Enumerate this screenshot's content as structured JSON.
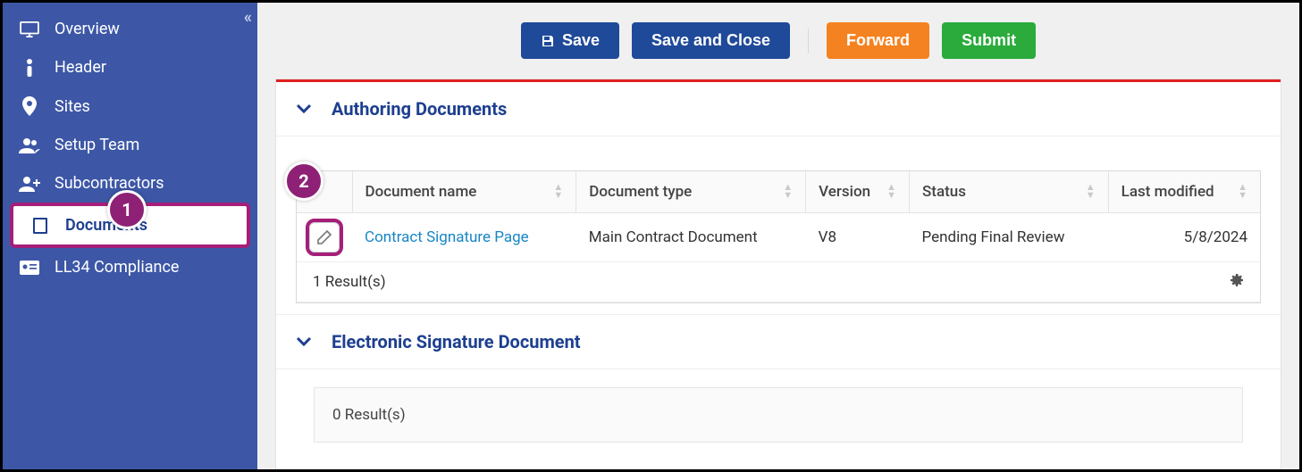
{
  "sidebar": {
    "items": [
      {
        "label": "Overview"
      },
      {
        "label": "Header"
      },
      {
        "label": "Sites"
      },
      {
        "label": "Setup Team"
      },
      {
        "label": "Subcontractors"
      },
      {
        "label": "Documents"
      },
      {
        "label": "LL34 Compliance"
      }
    ]
  },
  "toolbar": {
    "save": "Save",
    "save_close": "Save and Close",
    "forward": "Forward",
    "submit": "Submit"
  },
  "panel": {
    "title": "Authoring Documents",
    "columns": {
      "doc_name": "Document name",
      "doc_type": "Document type",
      "version": "Version",
      "status": "Status",
      "last_modified": "Last modified"
    },
    "row": {
      "doc_name": "Contract Signature Page",
      "doc_type": "Main Contract Document",
      "version": "V8",
      "status": "Pending Final Review",
      "last_modified": "5/8/2024"
    },
    "result_text": "1 Result(s)"
  },
  "sig_panel": {
    "title": "Electronic Signature Document",
    "result_text": "0 Result(s)"
  },
  "markers": {
    "m1": "1",
    "m2": "2"
  }
}
